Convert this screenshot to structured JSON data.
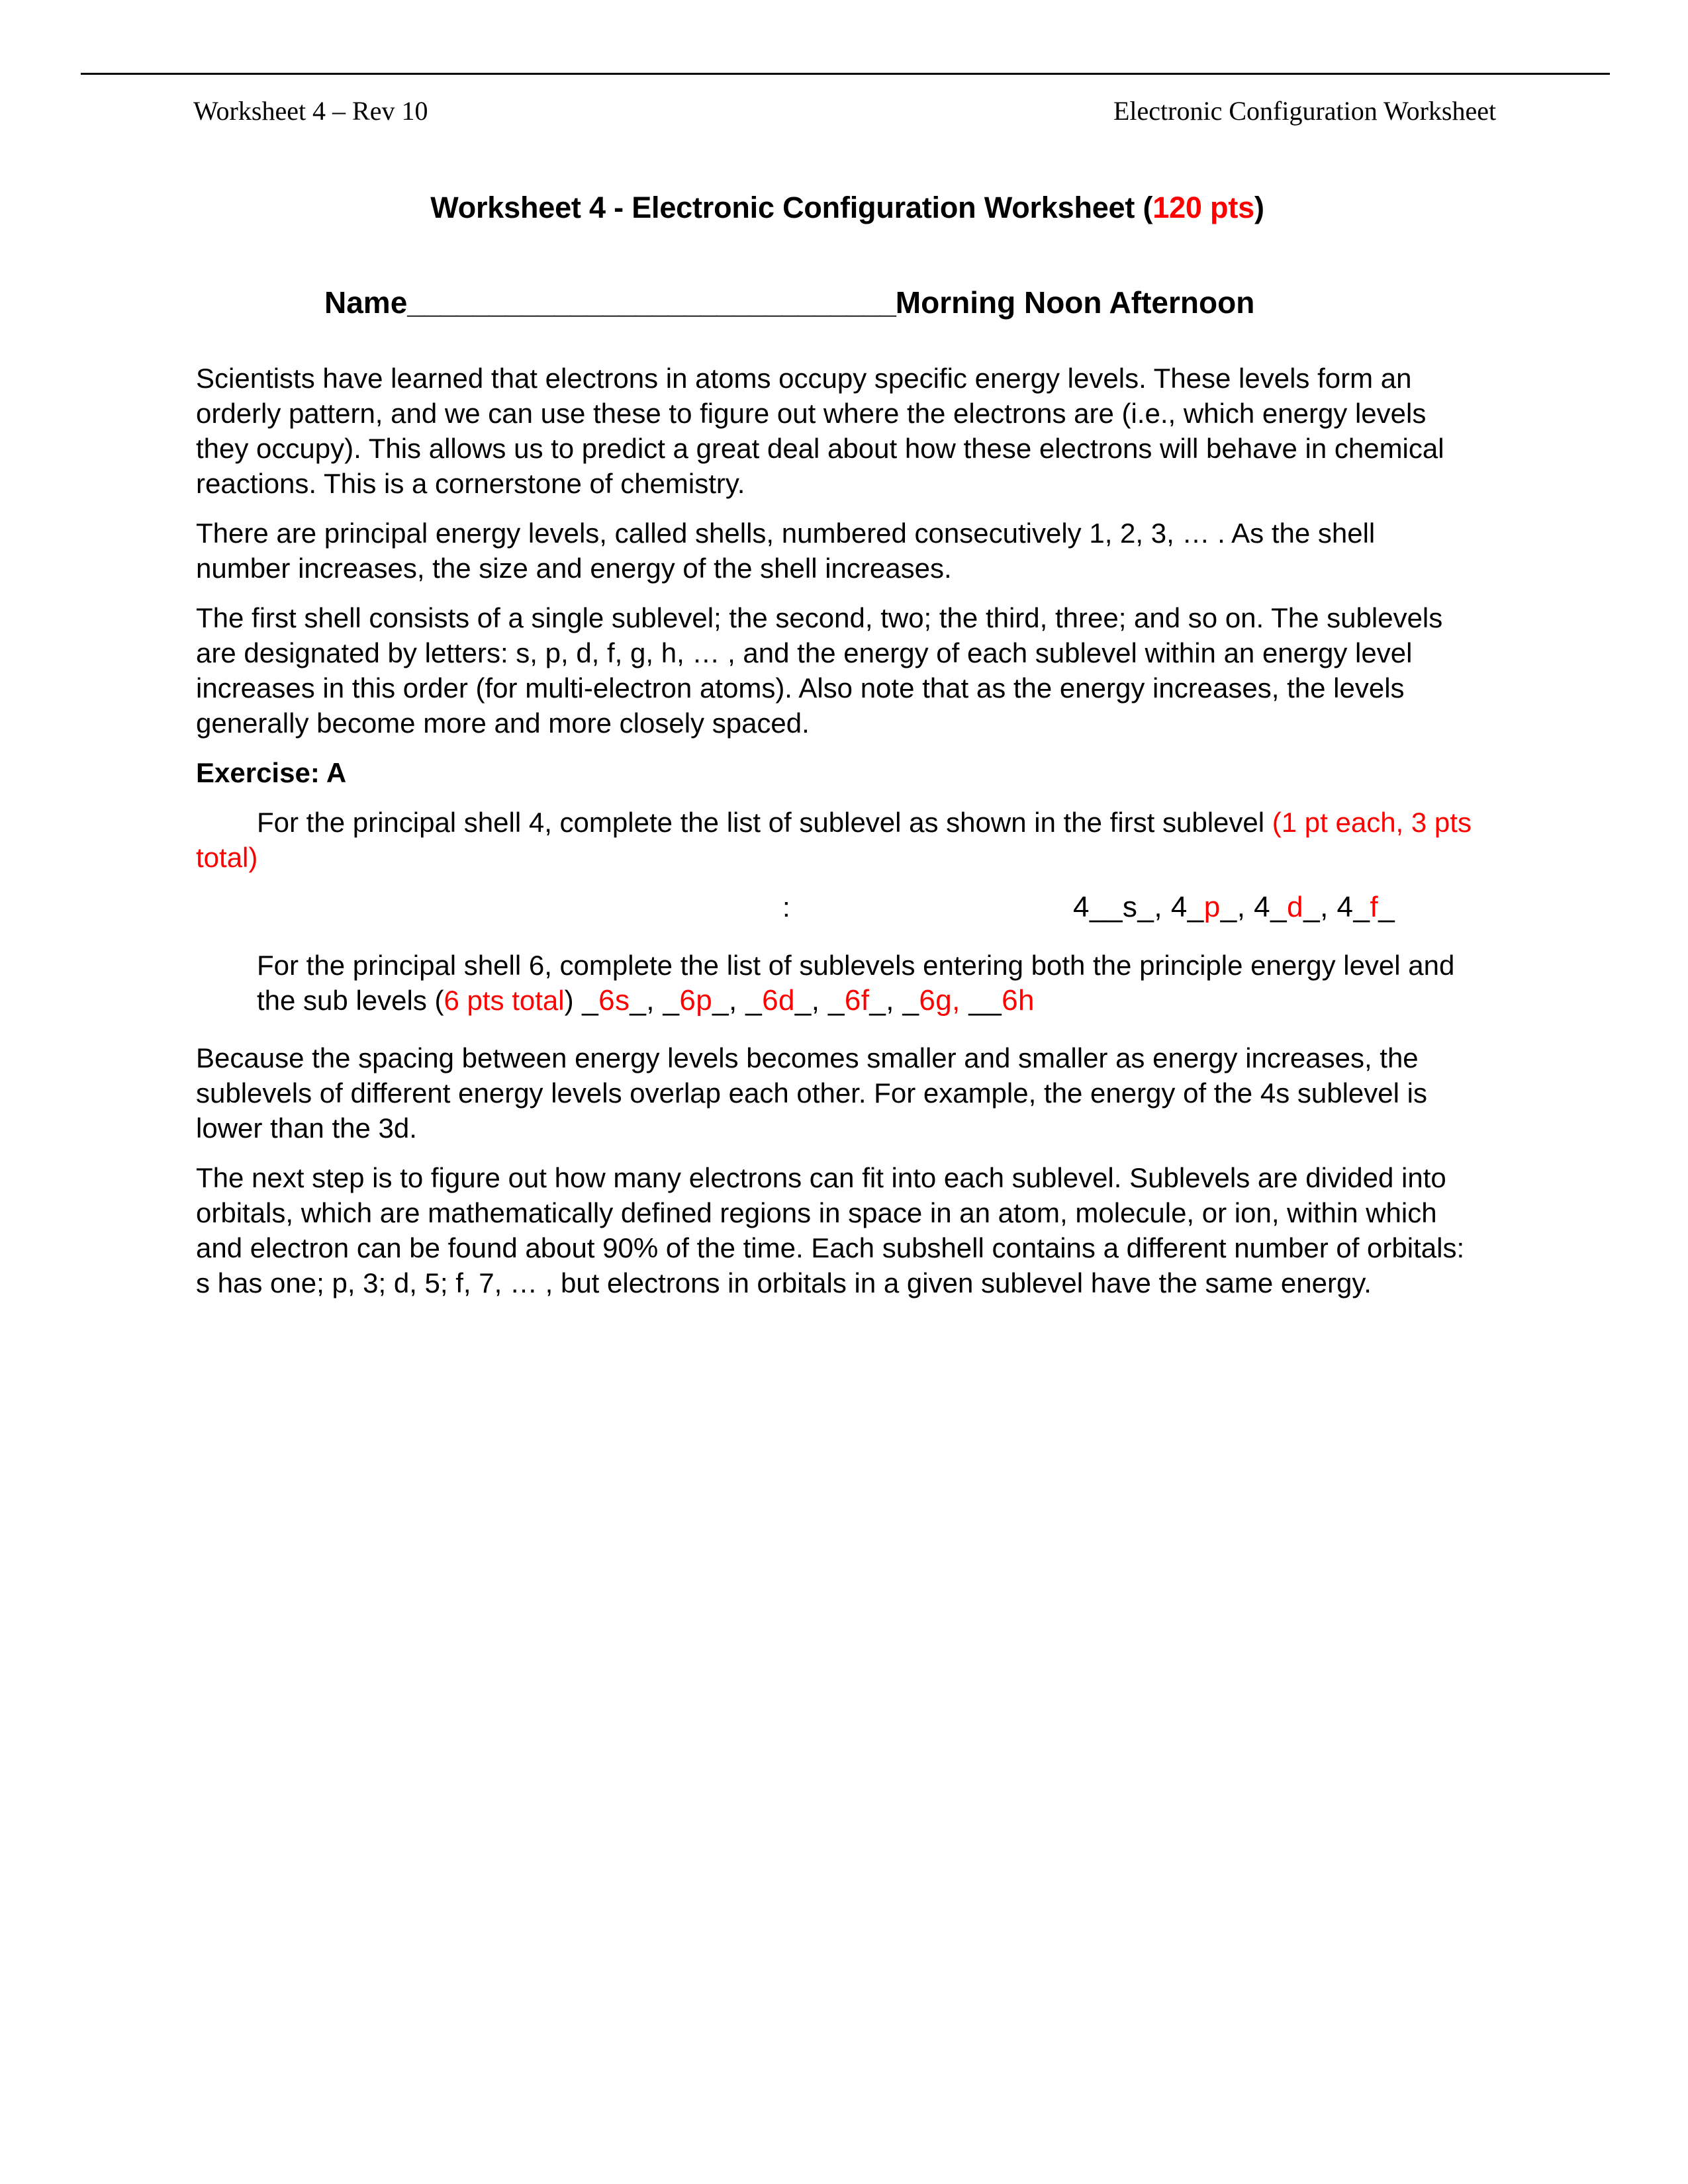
{
  "header": {
    "left": "Worksheet 4 – Rev 10",
    "right": "Electronic Configuration Worksheet"
  },
  "title": {
    "main": "Worksheet 4 - Electronic Configuration Worksheet (",
    "points": "120 pts",
    "close": ")"
  },
  "name_line": {
    "label": "Name",
    "blank": "______________________________",
    "options": "Morning   Noon   Afternoon"
  },
  "body": {
    "p1": "Scientists have learned that electrons in atoms occupy specific energy levels.  These levels form an orderly pattern, and we can use these to figure out where the electrons are (i.e., which energy levels they occupy).  This allows us to predict a great deal about how these electrons will behave in chemical reactions.  This is a cornerstone of chemistry.",
    "p2": "There are principal energy levels, called shells, numbered consecutively 1, 2, 3, … .  As the shell number increases, the size and energy of the shell increases.",
    "p3": "The first shell consists of a single sublevel; the second, two; the third, three; and so on.  The sublevels are designated by letters:  s, p, d, f, g, h, … , and the energy of each sublevel within an energy level increases in this order (for multi-electron atoms).  Also note that as the energy increases, the levels generally become more and more closely spaced.",
    "p4": "Because the spacing between energy levels becomes smaller and smaller as energy increases, the sublevels of different energy levels overlap each other.  For example, the energy of the 4s sublevel is lower than the 3d.",
    "p5": "The next step is to figure out how many electrons can fit into each sublevel.  Sublevels are divided into orbitals, which are mathematically defined regions in space in an atom, molecule, or ion, within which and electron can be found about 90% of the time.  Each subshell contains a different number of orbitals:  s has one; p, 3; d, 5; f, 7, … , but electrons in orbitals in a given sublevel have the same energy."
  },
  "exercise": {
    "heading": "Exercise: A",
    "q1_text": "For the principal shell 4, complete the list of sublevel as shown in the first sublevel ",
    "q1_points": "(1 pt each, 3 pts total)",
    "q1_answer": {
      "colon": ":",
      "seg1": "4__s_, 4_",
      "seg2": "p",
      "seg3": "_, 4_",
      "seg4": "d",
      "seg5": "_, 4_",
      "seg6": "f",
      "seg7": "_"
    },
    "q2_text": "For the principal shell 6, complete the list of sublevels entering both the principle energy level and the sub levels (",
    "q2_points": "6 pts total",
    "q2_close": ")",
    "q2_answer": {
      "a1_u": " _",
      "a1_r": "6s",
      "a2_u": "_, _",
      "a2_r": "6p",
      "a3_u": "_, _",
      "a3_r": "6d",
      "a4_u": "_, _",
      "a4_r": "6f",
      "a5_u": "_, _",
      "a5_r": "6g,",
      "a6_u": " __",
      "a6_r": "6h"
    }
  },
  "colors": {
    "accent_red": "#ff0000",
    "text_black": "#000000",
    "page_background": "#ffffff"
  }
}
